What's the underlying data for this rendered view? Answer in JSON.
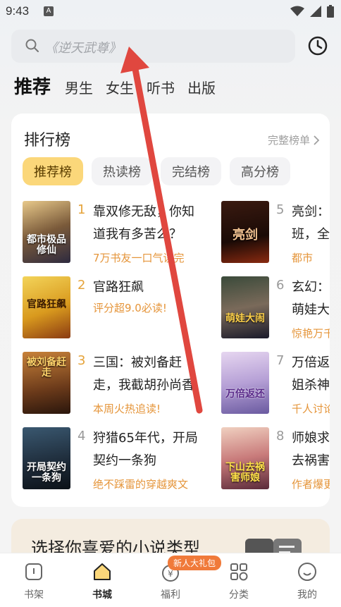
{
  "status": {
    "time": "9:43",
    "notification_letter": "A"
  },
  "search": {
    "placeholder": "《逆天武尊》"
  },
  "tabs": [
    {
      "label": "推荐",
      "active": true
    },
    {
      "label": "男生"
    },
    {
      "label": "女生"
    },
    {
      "label": "听书"
    },
    {
      "label": "出版"
    }
  ],
  "ranking": {
    "title": "排行榜",
    "more_label": "完整榜单",
    "chips": [
      "推荐榜",
      "热读榜",
      "完结榜",
      "高分榜"
    ],
    "books": [
      {
        "rank": "1",
        "title_line1": "靠双修无敌，你知",
        "title_line2": "道我有多苦么？",
        "tag": "7万书友一口气读完",
        "cover_text": "都市极品修仙"
      },
      {
        "rank": "2",
        "title_line1": "官路狂飙",
        "title_line2": "",
        "tag": "评分超9.0必读!",
        "cover_text": "官路狂飙"
      },
      {
        "rank": "3",
        "title_line1": "三国：被刘备赶",
        "title_line2": "走，我截胡孙尚香",
        "tag": "本周火热追读!",
        "cover_text": "被刘备赶走"
      },
      {
        "rank": "4",
        "title_line1": "狩猎65年代，开局",
        "title_line2": "契约一条狗",
        "tag": "绝不踩雷的穿越爽文",
        "cover_text": "开局契约一条狗"
      },
      {
        "rank": "5",
        "title_line1": "亮剑：",
        "title_line2": "班，全",
        "tag": "都市",
        "cover_text": "亮剑"
      },
      {
        "rank": "6",
        "title_line1": "玄幻：",
        "title_line2": "萌娃大",
        "tag": "惊艳万千",
        "cover_text": "萌娃大闹"
      },
      {
        "rank": "7",
        "title_line1": "万倍返",
        "title_line2": "姐杀神",
        "tag": "千人讨论",
        "cover_text": "万倍返还"
      },
      {
        "rank": "8",
        "title_line1": "师娘求",
        "title_line2": "去祸害",
        "tag": "作者爆更",
        "cover_text": "下山去祸害师娘"
      }
    ]
  },
  "promo": {
    "text": "选择你喜爱的小说类型"
  },
  "bottom_nav": {
    "items": [
      {
        "label": "书架"
      },
      {
        "label": "书城",
        "active": true
      },
      {
        "label": "福利"
      },
      {
        "label": "分类"
      },
      {
        "label": "我的"
      }
    ],
    "badge": "新人大礼包"
  },
  "colors": {
    "accent": "#fbd77a",
    "tag": "#e5953a",
    "arrow": "#e0473f"
  }
}
